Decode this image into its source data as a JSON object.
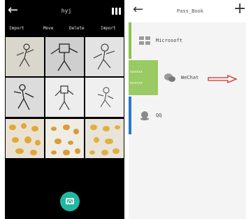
{
  "left_screen": {
    "title": "hyj",
    "back_icon": "back-arrow-icon",
    "menu_icon": "column-bars-icon",
    "actions": [
      "Import",
      "Move",
      "Delete",
      "Import"
    ],
    "photos": [
      {
        "subject": "robot sketch"
      },
      {
        "subject": "robot sketch"
      },
      {
        "subject": "robot sketch"
      },
      {
        "subject": "robot sketch"
      },
      {
        "subject": "robot sketch"
      },
      {
        "subject": "robot sketch"
      },
      {
        "subject": "figurines"
      },
      {
        "subject": "figurines"
      },
      {
        "subject": "figurines"
      }
    ],
    "camera_button_icon": "camera-icon",
    "camera_button_color": "#22b8a0"
  },
  "right_screen": {
    "title": "Pass_Book",
    "back_icon": "back-arrow-icon",
    "add_icon": "plus-icon",
    "items": [
      {
        "label": "Microsoft",
        "icon": "windows-icon"
      },
      {
        "label": "WeChat",
        "icon": "wechat-icon"
      },
      {
        "label": "QQ",
        "icon": "qq-icon"
      }
    ],
    "swipe_actions": [
      "xxxxxx",
      "xxxxxx"
    ],
    "accent_green": "#8bc34a",
    "accent_blue": "#2979c9",
    "annotation_arrow_color": "#d0302a"
  }
}
